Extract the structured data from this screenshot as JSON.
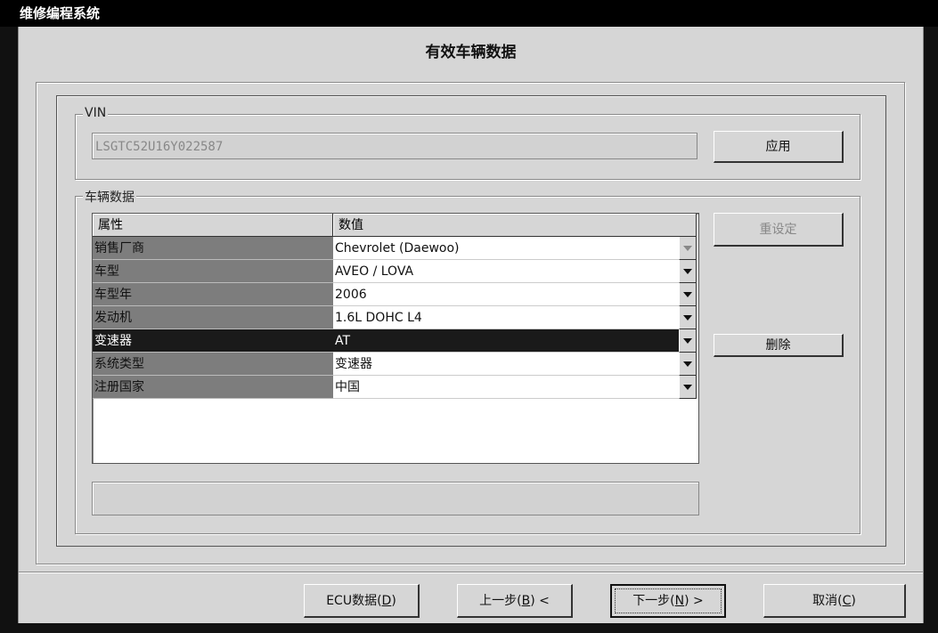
{
  "window": {
    "title": "维修编程系统"
  },
  "page": {
    "heading": "有效车辆数据"
  },
  "vin_group": {
    "label": "VIN",
    "vin_value": "LSGTC52U16Y022587",
    "apply_button": "应用"
  },
  "vehicle_group": {
    "label": "车辆数据",
    "columns": [
      "属性",
      "数值"
    ],
    "rows": [
      {
        "property": "销售厂商",
        "value": "Chevrolet (Daewoo)"
      },
      {
        "property": "车型",
        "value": "AVEO / LOVA"
      },
      {
        "property": "车型年",
        "value": "2006"
      },
      {
        "property": "发动机",
        "value": "1.6L DOHC L4"
      },
      {
        "property": "变速器",
        "value": "AT"
      },
      {
        "property": "系统类型",
        "value": "变速器"
      },
      {
        "property": "注册国家",
        "value": "中国"
      }
    ],
    "reset_button": "重设定",
    "delete_button": "删除",
    "status_text": ""
  },
  "footer": {
    "ecu_button": {
      "text": "ECU数据(",
      "key": "D",
      "tail": ")"
    },
    "back_button": {
      "text": "上一步(",
      "key": "B",
      "tail": ") <"
    },
    "next_button": {
      "text": "下一步(",
      "key": "N",
      "tail": ") >"
    },
    "cancel_button": {
      "text": "取消(",
      "key": "C",
      "tail": ")"
    }
  }
}
